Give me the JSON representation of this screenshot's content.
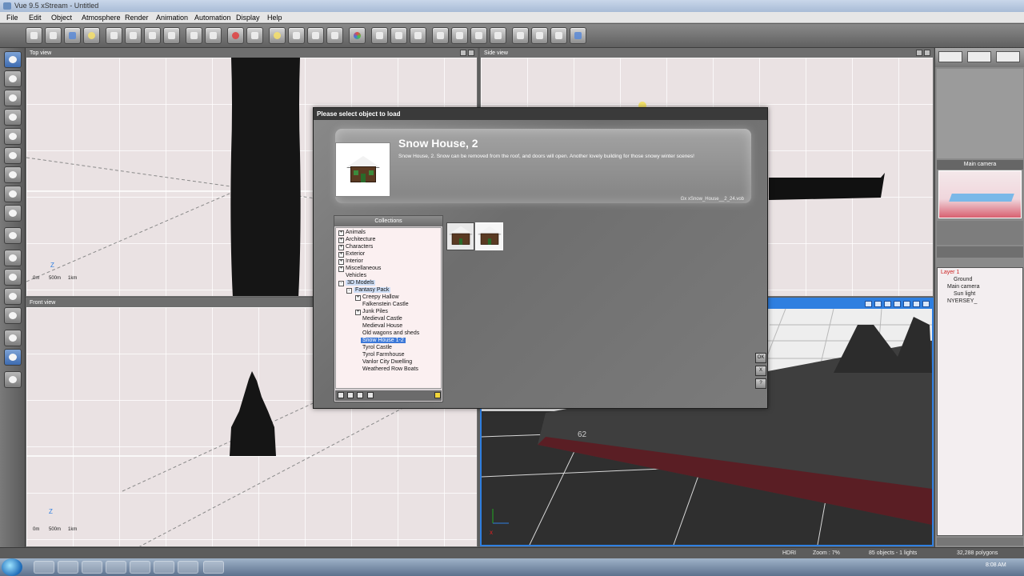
{
  "app": {
    "title": "Vue 9.5 xStream - Untitled"
  },
  "menu": [
    "File",
    "Edit",
    "Object",
    "Atmosphere",
    "Render",
    "Animation",
    "Automation",
    "Display",
    "Help"
  ],
  "viewports": {
    "top": {
      "label": "Top view",
      "scale": [
        "0m",
        "500m",
        "1km"
      ]
    },
    "side": {
      "label": "Side view"
    },
    "front": {
      "label": "Front view",
      "scale": [
        "0m",
        "500m",
        "1km"
      ]
    }
  },
  "dialog": {
    "title": "Please select object to load",
    "object_name": "Snow House, 2",
    "description": "Snow House, 2. Snow can be removed from the roof, and doors will open. Another lovely building for those snowy winter scenes!",
    "file_path": "Gx xSnow_House__2_24.vob",
    "collections_header": "Collections",
    "tree": [
      {
        "label": "Animals",
        "indent": 0,
        "expander": "+"
      },
      {
        "label": "Architecture",
        "indent": 0,
        "expander": "+"
      },
      {
        "label": "Characters",
        "indent": 0,
        "expander": "+"
      },
      {
        "label": "Exterior",
        "indent": 0,
        "expander": "+"
      },
      {
        "label": "Interior",
        "indent": 0,
        "expander": "+"
      },
      {
        "label": "Miscellaneous",
        "indent": 0,
        "expander": "+"
      },
      {
        "label": "Vehicles",
        "indent": 0,
        "expander": ""
      },
      {
        "label": "3D Models",
        "indent": 0,
        "expander": "-",
        "state": "hl"
      },
      {
        "label": "Fantasy Pack",
        "indent": 1,
        "expander": "-",
        "state": "hl"
      },
      {
        "label": "Creepy Hallow",
        "indent": 2,
        "expander": "+"
      },
      {
        "label": "Falkenstein Castle",
        "indent": 2,
        "expander": ""
      },
      {
        "label": "Junk Piles",
        "indent": 2,
        "expander": "+"
      },
      {
        "label": "Medieval Castle",
        "indent": 2,
        "expander": ""
      },
      {
        "label": "Medieval House",
        "indent": 2,
        "expander": ""
      },
      {
        "label": "Old wagons and sheds",
        "indent": 2,
        "expander": ""
      },
      {
        "label": "Snow House 1-2",
        "indent": 2,
        "expander": "",
        "state": "sel"
      },
      {
        "label": "Tyrol Castle",
        "indent": 2,
        "expander": ""
      },
      {
        "label": "Tyrol Farmhouse",
        "indent": 2,
        "expander": ""
      },
      {
        "label": "Vanlor City Dwelling",
        "indent": 2,
        "expander": ""
      },
      {
        "label": "Weathered Row Boats",
        "indent": 2,
        "expander": ""
      }
    ],
    "buttons": [
      "OK",
      "X",
      "?"
    ]
  },
  "right_panel": {
    "camera_label": "Main camera",
    "layers": [
      {
        "label": "Layer 1",
        "indent": 0,
        "color": "#cc2222"
      },
      {
        "label": "Ground",
        "indent": 2,
        "color": "#222222"
      },
      {
        "label": "Main camera",
        "indent": 1,
        "color": "#222222"
      },
      {
        "label": "Sun light",
        "indent": 2,
        "color": "#222222"
      },
      {
        "label": "NYERSEY_",
        "indent": 1,
        "color": "#222222"
      }
    ]
  },
  "status": {
    "mode": "HDRI",
    "zoom": "Zoom : 7%",
    "objects": "85 objects - 1 lights",
    "polygons": "32,288 polygons"
  },
  "taskbar": {
    "time": "8:08 AM"
  },
  "colors": {
    "accent": "#2f7fe0",
    "selection": "#3c78d8",
    "viewport_bg": "#eae2e3"
  }
}
